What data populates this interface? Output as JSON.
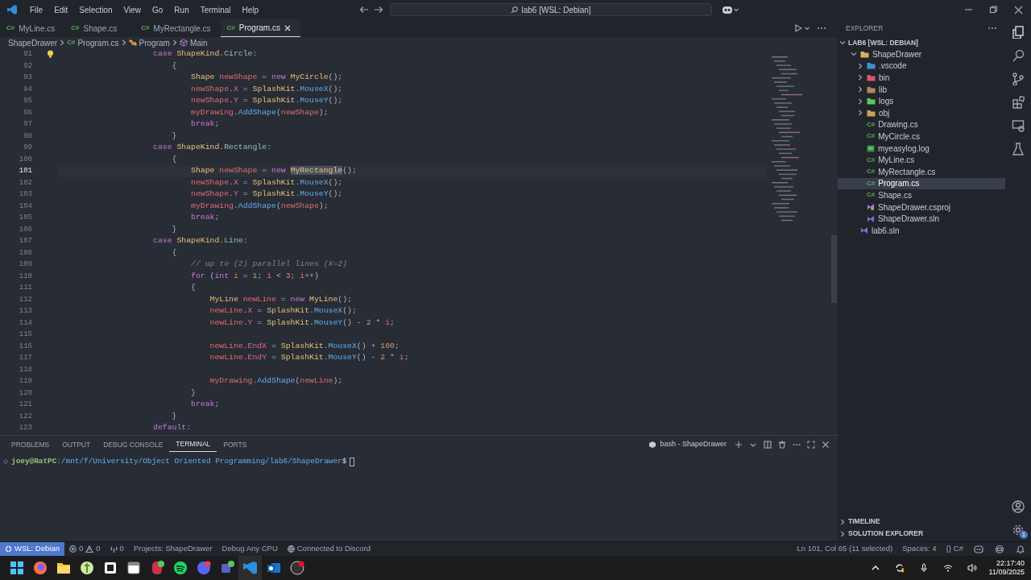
{
  "title_bar": {
    "menu": [
      "File",
      "Edit",
      "Selection",
      "View",
      "Go",
      "Run",
      "Terminal",
      "Help"
    ],
    "search": "lab6 [WSL: Debian]"
  },
  "tabs": [
    {
      "icon": "C#",
      "label": "MyLine.cs",
      "selected": false
    },
    {
      "icon": "C#",
      "label": "Shape.cs",
      "selected": false
    },
    {
      "icon": "C#",
      "label": "MyRectangle.cs",
      "selected": false
    },
    {
      "icon": "C#",
      "label": "Program.cs",
      "selected": true
    }
  ],
  "breadcrumb": [
    {
      "kind": "folder",
      "label": "ShapeDrawer"
    },
    {
      "kind": "file",
      "icon": "C#",
      "label": "Program.cs"
    },
    {
      "kind": "class",
      "label": "Program"
    },
    {
      "kind": "method",
      "label": "Main"
    }
  ],
  "code": [
    {
      "number": "91",
      "current": false,
      "tokens": [
        {
          "text": "case",
          "kind": "kw"
        },
        {
          "text": " ShapeKind",
          "kind": "type"
        },
        {
          "text": ".",
          "kind": "p"
        },
        {
          "text": "Circle",
          "kind": "enum"
        },
        {
          "text": ":",
          "kind": "p"
        }
      ],
      "children": [
        {
          "number": "92",
          "current": false,
          "tokens": [
            {
              "text": "{",
              "kind": "p"
            }
          ],
          "children": [
            {
              "number": "93",
              "current": false,
              "tokens": [
                {
                  "text": "Shape ",
                  "kind": "type"
                },
                {
                  "text": "newShape",
                  "kind": "var"
                },
                {
                  "text": " = ",
                  "kind": "p"
                },
                {
                  "text": "new ",
                  "kind": "kw"
                },
                {
                  "text": "MyCircle",
                  "kind": "type"
                },
                {
                  "text": "();",
                  "kind": "p"
                }
              ]
            },
            {
              "number": "94",
              "current": false,
              "tokens": [
                {
                  "text": "newShape",
                  "kind": "var"
                },
                {
                  "text": ".",
                  "kind": "p"
                },
                {
                  "text": "X",
                  "kind": "var"
                },
                {
                  "text": " = ",
                  "kind": "p"
                },
                {
                  "text": "SplashKit",
                  "kind": "type"
                },
                {
                  "text": ".",
                  "kind": "p"
                },
                {
                  "text": "MouseX",
                  "kind": "fn"
                },
                {
                  "text": "();",
                  "kind": "p"
                }
              ]
            },
            {
              "number": "95",
              "current": false,
              "tokens": [
                {
                  "text": "newShape",
                  "kind": "var"
                },
                {
                  "text": ".",
                  "kind": "p"
                },
                {
                  "text": "Y",
                  "kind": "var"
                },
                {
                  "text": " = ",
                  "kind": "p"
                },
                {
                  "text": "SplashKit",
                  "kind": "type"
                },
                {
                  "text": ".",
                  "kind": "p"
                },
                {
                  "text": "MouseY",
                  "kind": "fn"
                },
                {
                  "text": "();",
                  "kind": "p"
                }
              ]
            },
            {
              "number": "96",
              "current": false,
              "tokens": [
                {
                  "text": "myDrawing",
                  "kind": "var"
                },
                {
                  "text": ".",
                  "kind": "p"
                },
                {
                  "text": "AddShape",
                  "kind": "fn"
                },
                {
                  "text": "(",
                  "kind": "p"
                },
                {
                  "text": "newShape",
                  "kind": "var"
                },
                {
                  "text": ");",
                  "kind": "p"
                }
              ]
            },
            {
              "number": "97",
              "current": false,
              "tokens": [
                {
                  "text": "break",
                  "kind": "kw"
                },
                {
                  "text": ";",
                  "kind": "p"
                }
              ]
            }
          ]
        },
        {
          "number": "98",
          "current": false,
          "tokens": [
            {
              "text": "}",
              "kind": "p"
            }
          ]
        }
      ]
    },
    {
      "number": "99",
      "current": false,
      "tokens": [
        {
          "text": "case",
          "kind": "kw"
        },
        {
          "text": " ShapeKind",
          "kind": "type"
        },
        {
          "text": ".",
          "kind": "p"
        },
        {
          "text": "Rectangle",
          "kind": "enum"
        },
        {
          "text": ":",
          "kind": "p"
        }
      ],
      "children": [
        {
          "number": "100",
          "current": false,
          "tokens": [
            {
              "text": "{",
              "kind": "p"
            }
          ],
          "children": [
            {
              "number": "101",
              "current": true,
              "tokens": [
                {
                  "text": "Shape ",
                  "kind": "type"
                },
                {
                  "text": "newShape",
                  "kind": "var"
                },
                {
                  "text": " = ",
                  "kind": "p"
                },
                {
                  "text": "new ",
                  "kind": "kw"
                },
                {
                  "text": "MyRectangle",
                  "kind": "sel"
                },
                {
                  "text": "();",
                  "kind": "p"
                }
              ]
            },
            {
              "number": "102",
              "current": false,
              "tokens": [
                {
                  "text": "newShape",
                  "kind": "var"
                },
                {
                  "text": ".",
                  "kind": "p"
                },
                {
                  "text": "X",
                  "kind": "var"
                },
                {
                  "text": " = ",
                  "kind": "p"
                },
                {
                  "text": "SplashKit",
                  "kind": "type"
                },
                {
                  "text": ".",
                  "kind": "p"
                },
                {
                  "text": "MouseX",
                  "kind": "fn"
                },
                {
                  "text": "();",
                  "kind": "p"
                }
              ]
            },
            {
              "number": "103",
              "current": false,
              "tokens": [
                {
                  "text": "newShape",
                  "kind": "var"
                },
                {
                  "text": ".",
                  "kind": "p"
                },
                {
                  "text": "Y",
                  "kind": "var"
                },
                {
                  "text": " = ",
                  "kind": "p"
                },
                {
                  "text": "SplashKit",
                  "kind": "type"
                },
                {
                  "text": ".",
                  "kind": "p"
                },
                {
                  "text": "MouseY",
                  "kind": "fn"
                },
                {
                  "text": "();",
                  "kind": "p"
                }
              ]
            },
            {
              "number": "104",
              "current": false,
              "tokens": [
                {
                  "text": "myDrawing",
                  "kind": "var"
                },
                {
                  "text": ".",
                  "kind": "p"
                },
                {
                  "text": "AddShape",
                  "kind": "fn"
                },
                {
                  "text": "(",
                  "kind": "p"
                },
                {
                  "text": "newShape",
                  "kind": "var"
                },
                {
                  "text": ");",
                  "kind": "p"
                }
              ]
            },
            {
              "number": "105",
              "current": false,
              "tokens": [
                {
                  "text": "break",
                  "kind": "kw"
                },
                {
                  "text": ";",
                  "kind": "p"
                }
              ]
            }
          ]
        },
        {
          "number": "106",
          "current": false,
          "tokens": [
            {
              "text": "}",
              "kind": "p"
            }
          ]
        }
      ]
    },
    {
      "number": "107",
      "current": false,
      "tokens": [
        {
          "text": "case",
          "kind": "kw"
        },
        {
          "text": " ShapeKind",
          "kind": "type"
        },
        {
          "text": ".",
          "kind": "p"
        },
        {
          "text": "Line",
          "kind": "enum"
        },
        {
          "text": ":",
          "kind": "p"
        }
      ],
      "children": [
        {
          "number": "108",
          "current": false,
          "tokens": [
            {
              "text": "{",
              "kind": "p"
            }
          ],
          "children": [
            {
              "number": "109",
              "current": false,
              "tokens": [
                {
                  "text": "// up to (2) parallel lines (X=2)",
                  "kind": "comment"
                }
              ]
            },
            {
              "number": "110",
              "current": false,
              "tokens": [
                {
                  "text": "for",
                  "kind": "kw"
                },
                {
                  "text": " (",
                  "kind": "p"
                },
                {
                  "text": "int ",
                  "kind": "kw"
                },
                {
                  "text": "i",
                  "kind": "var"
                },
                {
                  "text": " = ",
                  "kind": "p"
                },
                {
                  "text": "1",
                  "kind": "num"
                },
                {
                  "text": "; ",
                  "kind": "p"
                },
                {
                  "text": "i",
                  "kind": "var"
                },
                {
                  "text": " < ",
                  "kind": "p"
                },
                {
                  "text": "3",
                  "kind": "num"
                },
                {
                  "text": "; ",
                  "kind": "p"
                },
                {
                  "text": "i",
                  "kind": "var"
                },
                {
                  "text": "++)",
                  "kind": "p"
                }
              ]
            },
            {
              "number": "111",
              "current": false,
              "tokens": [
                {
                  "text": "{",
                  "kind": "p"
                }
              ],
              "children": [
                {
                  "number": "112",
                  "current": false,
                  "tokens": [
                    {
                      "text": "MyLine ",
                      "kind": "type"
                    },
                    {
                      "text": "newLine",
                      "kind": "var"
                    },
                    {
                      "text": " = ",
                      "kind": "p"
                    },
                    {
                      "text": "new ",
                      "kind": "kw"
                    },
                    {
                      "text": "MyLine",
                      "kind": "type"
                    },
                    {
                      "text": "();",
                      "kind": "p"
                    }
                  ]
                },
                {
                  "number": "113",
                  "current": false,
                  "tokens": [
                    {
                      "text": "newLine",
                      "kind": "var"
                    },
                    {
                      "text": ".",
                      "kind": "p"
                    },
                    {
                      "text": "X",
                      "kind": "var"
                    },
                    {
                      "text": " = ",
                      "kind": "p"
                    },
                    {
                      "text": "SplashKit",
                      "kind": "type"
                    },
                    {
                      "text": ".",
                      "kind": "p"
                    },
                    {
                      "text": "MouseX",
                      "kind": "fn"
                    },
                    {
                      "text": "();",
                      "kind": "p"
                    }
                  ]
                },
                {
                  "number": "114",
                  "current": false,
                  "tokens": [
                    {
                      "text": "newLine",
                      "kind": "var"
                    },
                    {
                      "text": ".",
                      "kind": "p"
                    },
                    {
                      "text": "Y",
                      "kind": "var"
                    },
                    {
                      "text": " = ",
                      "kind": "p"
                    },
                    {
                      "text": "SplashKit",
                      "kind": "type"
                    },
                    {
                      "text": ".",
                      "kind": "p"
                    },
                    {
                      "text": "MouseY",
                      "kind": "fn"
                    },
                    {
                      "text": "() - ",
                      "kind": "p"
                    },
                    {
                      "text": "2",
                      "kind": "num"
                    },
                    {
                      "text": " * ",
                      "kind": "p"
                    },
                    {
                      "text": "i",
                      "kind": "var"
                    },
                    {
                      "text": ";",
                      "kind": "p"
                    }
                  ]
                },
                {
                  "number": "115",
                  "current": false
                },
                {
                  "number": "116",
                  "current": false,
                  "tokens": [
                    {
                      "text": "newLine",
                      "kind": "var"
                    },
                    {
                      "text": ".",
                      "kind": "p"
                    },
                    {
                      "text": "EndX",
                      "kind": "var"
                    },
                    {
                      "text": " = ",
                      "kind": "p"
                    },
                    {
                      "text": "SplashKit",
                      "kind": "type"
                    },
                    {
                      "text": ".",
                      "kind": "p"
                    },
                    {
                      "text": "MouseX",
                      "kind": "fn"
                    },
                    {
                      "text": "() + ",
                      "kind": "p"
                    },
                    {
                      "text": "100",
                      "kind": "num"
                    },
                    {
                      "text": ";",
                      "kind": "p"
                    }
                  ]
                },
                {
                  "number": "117",
                  "current": false,
                  "tokens": [
                    {
                      "text": "newLine",
                      "kind": "var"
                    },
                    {
                      "text": ".",
                      "kind": "p"
                    },
                    {
                      "text": "EndY",
                      "kind": "var"
                    },
                    {
                      "text": " = ",
                      "kind": "p"
                    },
                    {
                      "text": "SplashKit",
                      "kind": "type"
                    },
                    {
                      "text": ".",
                      "kind": "p"
                    },
                    {
                      "text": "MouseY",
                      "kind": "fn"
                    },
                    {
                      "text": "() - ",
                      "kind": "p"
                    },
                    {
                      "text": "2",
                      "kind": "num"
                    },
                    {
                      "text": " * ",
                      "kind": "p"
                    },
                    {
                      "text": "i",
                      "kind": "var"
                    },
                    {
                      "text": ";",
                      "kind": "p"
                    }
                  ]
                },
                {
                  "number": "118",
                  "current": false
                },
                {
                  "number": "119",
                  "current": false,
                  "tokens": [
                    {
                      "text": "myDrawing",
                      "kind": "var"
                    },
                    {
                      "text": ".",
                      "kind": "p"
                    },
                    {
                      "text": "AddShape",
                      "kind": "fn"
                    },
                    {
                      "text": "(",
                      "kind": "p"
                    },
                    {
                      "text": "newLine",
                      "kind": "var"
                    },
                    {
                      "text": ");",
                      "kind": "p"
                    }
                  ]
                }
              ]
            },
            {
              "number": "120",
              "current": false,
              "tokens": [
                {
                  "text": "}",
                  "kind": "p"
                }
              ]
            },
            {
              "number": "121",
              "current": false,
              "tokens": [
                {
                  "text": "break",
                  "kind": "kw"
                },
                {
                  "text": ";",
                  "kind": "p"
                }
              ]
            }
          ]
        },
        {
          "number": "122",
          "current": false,
          "tokens": [
            {
              "text": "}",
              "kind": "p"
            }
          ]
        }
      ]
    },
    {
      "number": "123",
      "current": false,
      "tokens": [
        {
          "text": "default",
          "kind": "kw"
        },
        {
          "text": ":",
          "kind": "p"
        }
      ]
    }
  ],
  "panel": {
    "tabs": [
      {
        "label": "PROBLEMS",
        "selected": false
      },
      {
        "label": "OUTPUT",
        "selected": false
      },
      {
        "label": "DEBUG CONSOLE",
        "selected": false
      },
      {
        "label": "TERMINAL",
        "selected": true
      },
      {
        "label": "PORTS",
        "selected": false
      }
    ],
    "terminal_name": "bash - ShapeDrawer",
    "prompt": {
      "user_host": "joey@RatPC",
      "path": ":/mnt/f/University/Object Oriented Programming/lab6/ShapeDrawer",
      "sign": "$"
    }
  },
  "explorer": {
    "title": "EXPLORER",
    "sections": [
      {
        "label": "LAB6 [WSL: DEBIAN]",
        "expanded": true,
        "tree": [
          {
            "kind": "folder",
            "label": "ShapeDrawer",
            "color": "#d9b25c",
            "expanded": true,
            "children": [
              {
                "kind": "folder",
                "label": ".vscode",
                "color": "#3f8fd6",
                "expanded": false
              },
              {
                "kind": "folder",
                "label": "bin",
                "color": "#d9546e",
                "expanded": false
              },
              {
                "kind": "folder",
                "label": "lib",
                "color": "#b08a5c",
                "expanded": false
              },
              {
                "kind": "folder",
                "label": "logs",
                "color": "#5cc85c",
                "expanded": false
              },
              {
                "kind": "folder",
                "label": "obj",
                "color": "#c9a25c",
                "expanded": false
              },
              {
                "kind": "cs",
                "icon": "C#",
                "label": "Drawing.cs",
                "selected": false
              },
              {
                "kind": "cs",
                "icon": "C#",
                "label": "MyCircle.cs",
                "selected": false
              },
              {
                "kind": "log",
                "label": "myeasylog.log",
                "selected": false
              },
              {
                "kind": "cs",
                "icon": "C#",
                "label": "MyLine.cs",
                "selected": false
              },
              {
                "kind": "cs",
                "icon": "C#",
                "label": "MyRectangle.cs",
                "selected": false
              },
              {
                "kind": "cs",
                "icon": "C#",
                "label": "Program.cs",
                "selected": true
              },
              {
                "kind": "cs",
                "icon": "C#",
                "label": "Shape.cs",
                "selected": false
              },
              {
                "kind": "csproj",
                "label": "ShapeDrawer.csproj",
                "selected": false
              },
              {
                "kind": "sln",
                "label": "ShapeDrawer.sln",
                "selected": false
              }
            ]
          },
          {
            "kind": "sln",
            "label": "lab6.sln",
            "selected": false
          }
        ]
      },
      {
        "label": "TIMELINE",
        "expanded": false
      },
      {
        "label": "SOLUTION EXPLORER",
        "expanded": false
      }
    ]
  },
  "settings_badge": "1",
  "status_bar": {
    "left": [
      {
        "kind": "remote",
        "label": "WSL: Debian"
      },
      {
        "kind": "problems",
        "errors": "0",
        "warnings": "0"
      },
      {
        "kind": "ports",
        "label": "0"
      },
      {
        "kind": "text",
        "label": "Projects: ShapeDrawer"
      },
      {
        "kind": "text",
        "label": "Debug Any CPU"
      },
      {
        "kind": "discord",
        "label": "Connected to Discord"
      }
    ],
    "right": [
      {
        "kind": "text",
        "label": "Ln 101, Col 65 (11 selected)"
      },
      {
        "kind": "text",
        "label": "Spaces: 4"
      },
      {
        "kind": "language",
        "icon": "{}",
        "label": "C#"
      }
    ]
  },
  "taskbar": {
    "time": "22:17:40",
    "date": "11/09/2025"
  }
}
